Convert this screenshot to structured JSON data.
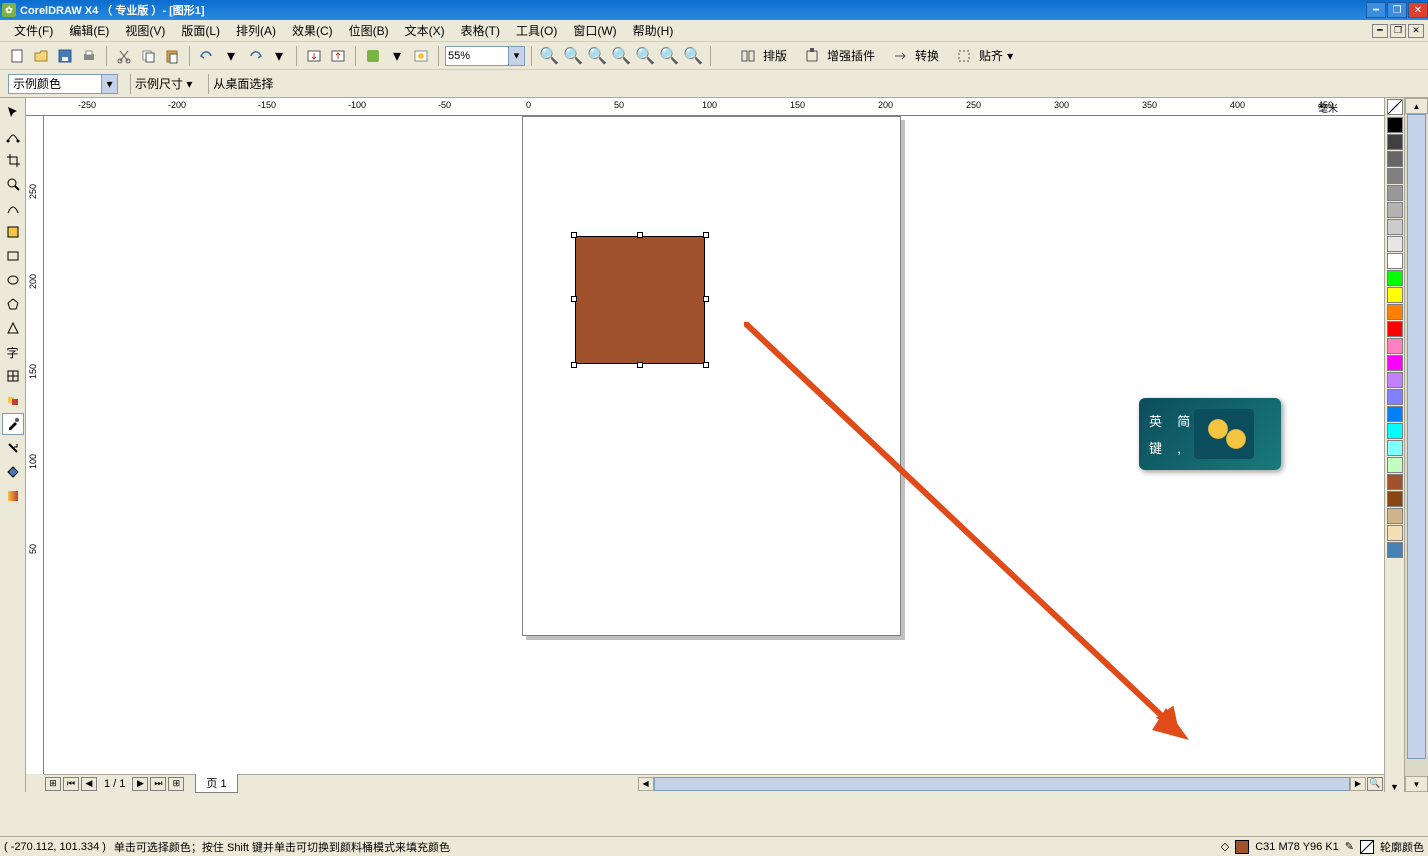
{
  "title": "CorelDRAW X4 （ 专业版 ）- [图形1]",
  "menu": [
    "文件(F)",
    "编辑(E)",
    "视图(V)",
    "版面(L)",
    "排列(A)",
    "效果(C)",
    "位图(B)",
    "文本(X)",
    "表格(T)",
    "工具(O)",
    "窗口(W)",
    "帮助(H)"
  ],
  "toolbar1": {
    "zoom": "55%",
    "groups": [
      {
        "name": "排版"
      },
      {
        "name": "增强插件"
      },
      {
        "name": "转换"
      },
      {
        "name": "贴齐"
      }
    ]
  },
  "toolbar2": {
    "combo": "示例颜色",
    "label1": "示例尺寸 ▾",
    "label2": "从桌面选择"
  },
  "ruler": {
    "unit": "毫米",
    "h": [
      "-250",
      "-200",
      "-150",
      "-100",
      "-50",
      "0",
      "50",
      "100",
      "150",
      "200",
      "250",
      "300",
      "350",
      "400",
      "450"
    ],
    "v": [
      "250",
      "200",
      "150",
      "100",
      "50"
    ]
  },
  "page_tabs": {
    "counter": "1 / 1",
    "tab": "页 1"
  },
  "status": {
    "coord": "( -270.112, 101.334 )",
    "hint": "单击可选择颜色；按住 Shift 键并单击可切换到颜料桶模式来填充颜色",
    "fill_code": "C31 M78 Y96 K1",
    "outline": "轮廓颜色"
  },
  "ime": {
    "t1": "英",
    "t2": "简",
    "t3": "键",
    "t4": ","
  },
  "palette": [
    "none",
    "#000000",
    "#404040",
    "#666666",
    "#808080",
    "#999999",
    "#b3b3b3",
    "#cccccc",
    "#e6e6e6",
    "#ffffff",
    "#00ff00",
    "#ffff00",
    "#ff8000",
    "#ff0000",
    "#ff80c0",
    "#ff00ff",
    "#c080ff",
    "#8080ff",
    "#0080ff",
    "#00ffff",
    "#80ffff",
    "#c0ffc0",
    "#a0522d",
    "#8b4513",
    "#d2b48c",
    "#f5deb3",
    "#4682b4"
  ],
  "fill_color": "#a0522d"
}
